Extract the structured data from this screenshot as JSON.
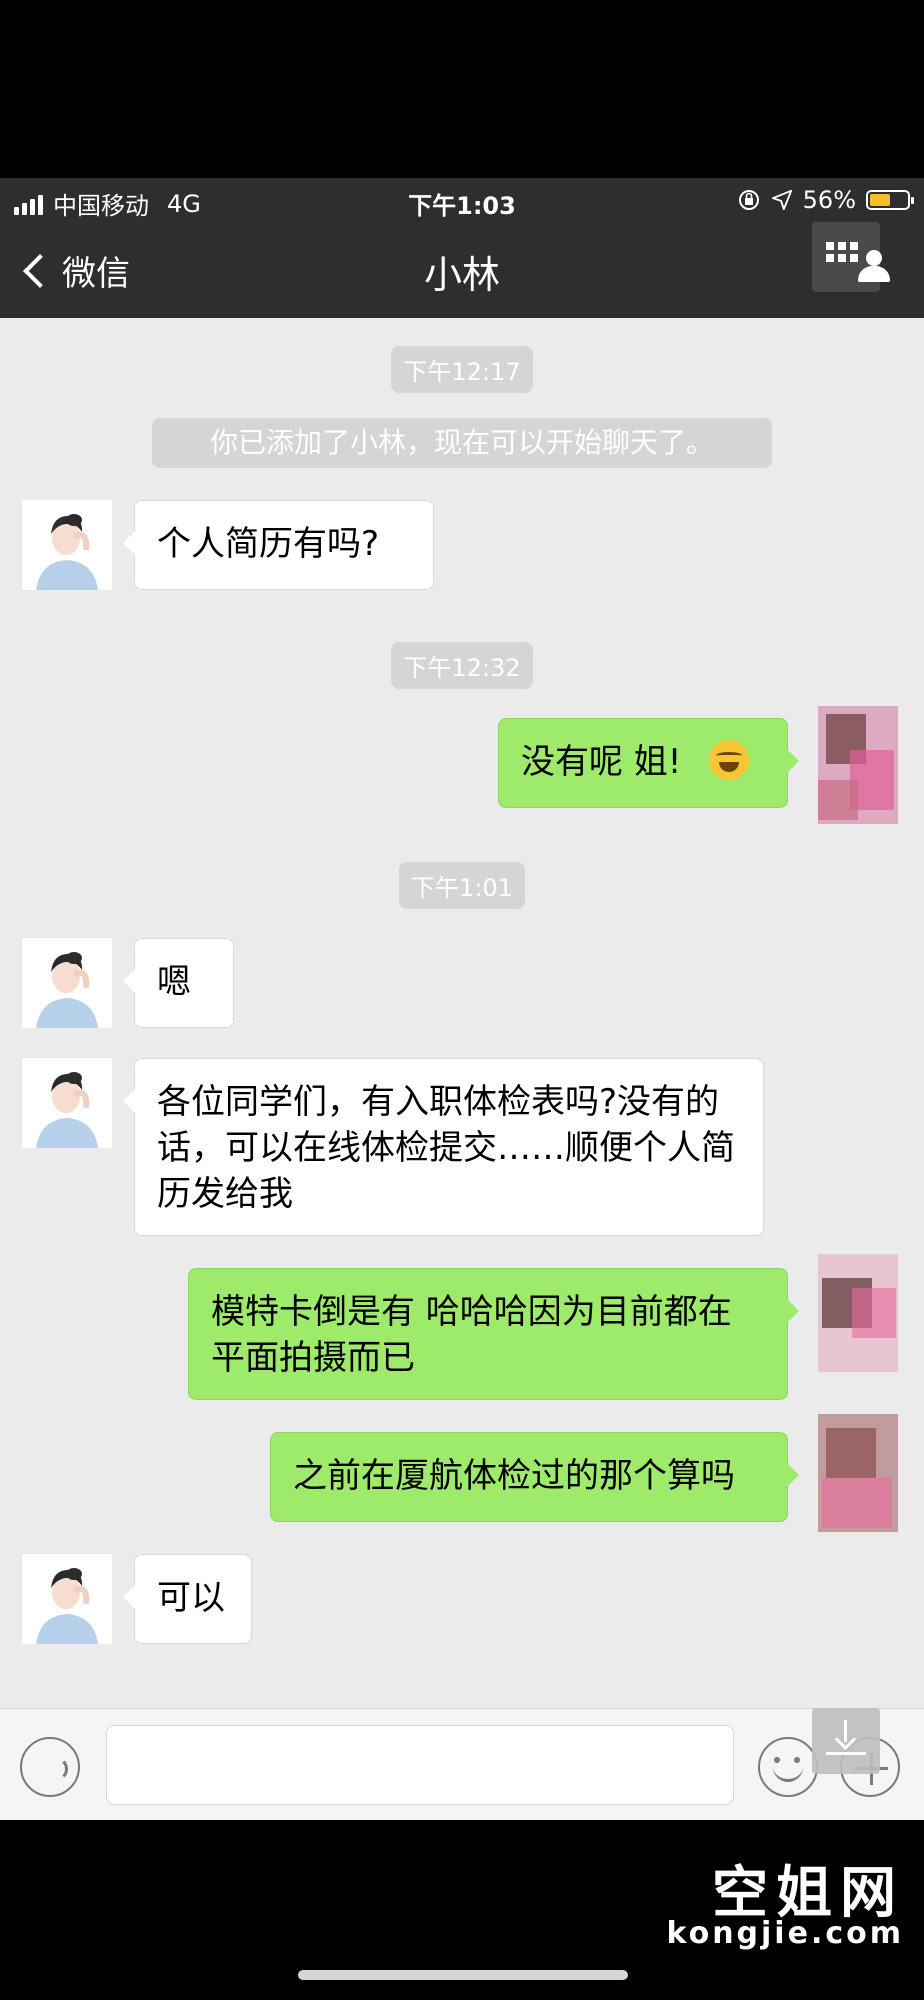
{
  "status_bar": {
    "carrier": "中国移动",
    "network": "4G",
    "time": "下午1:03",
    "battery": "56%",
    "battery_level": 0.56
  },
  "nav": {
    "back_label": "微信",
    "title": "小林"
  },
  "messages": {
    "t1": "下午12:17",
    "system": "你已添加了小林，现在可以开始聊天了。",
    "m1": "个人简历有吗?",
    "t2": "下午12:32",
    "m2": "没有呢 姐!",
    "t3": "下午1:01",
    "m3": "嗯",
    "m4": "各位同学们，有入职体检表吗?没有的话，可以在线体检提交……顺便个人简历发给我",
    "m5": "模特卡倒是有 哈哈哈因为目前都在平面拍摄而已",
    "m6": "之前在厦航体检过的那个算吗",
    "m7": "可以"
  },
  "watermark": {
    "cn": "空姐网",
    "en": "kongjie.com"
  }
}
